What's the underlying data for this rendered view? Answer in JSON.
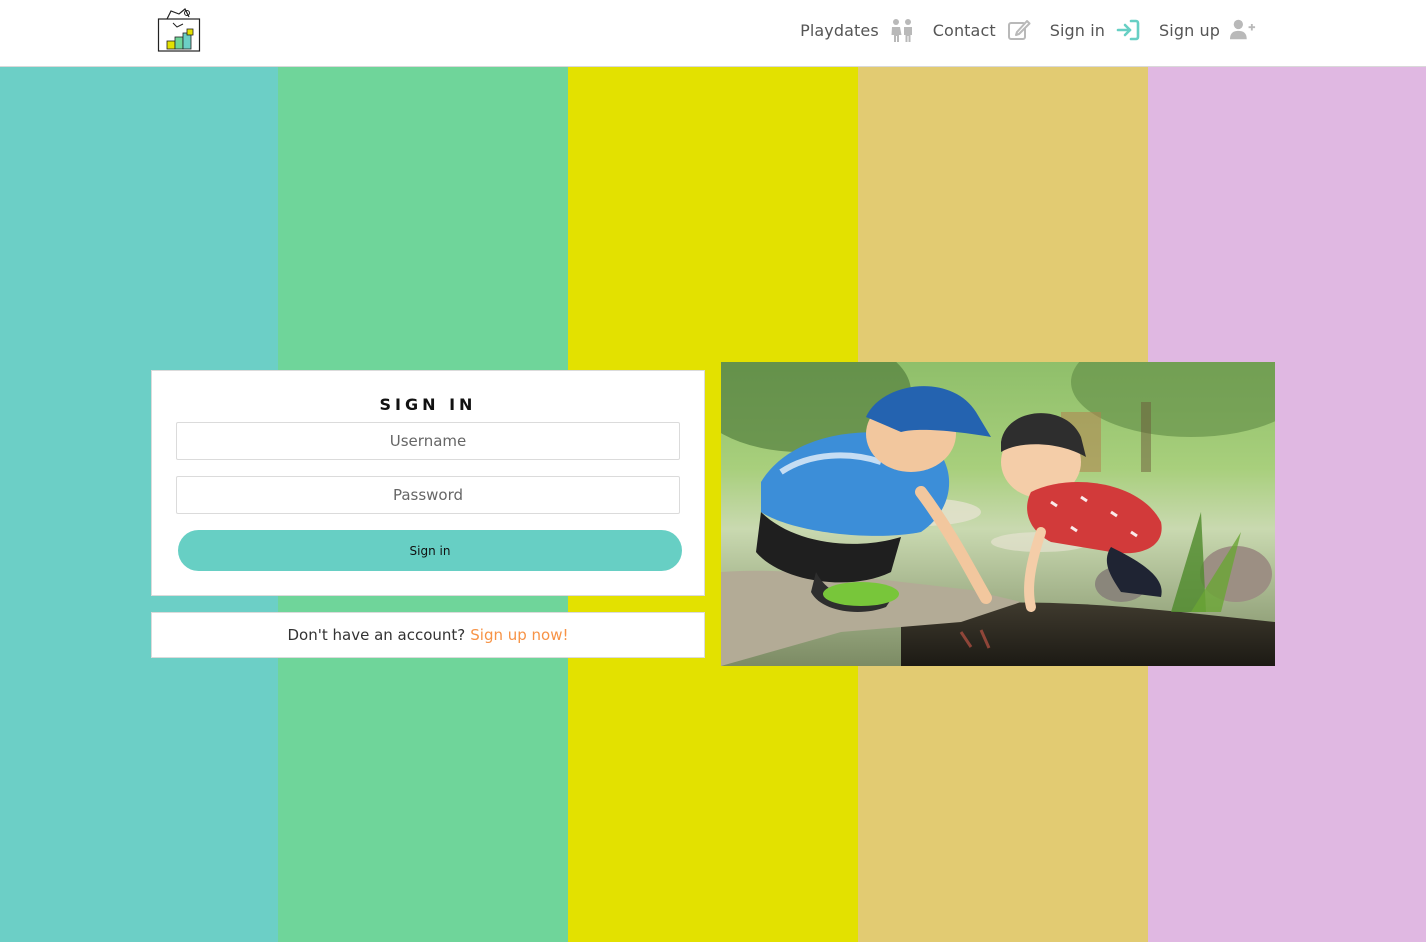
{
  "colors": {
    "stripes": [
      "#6ccfc6",
      "#6fd59a",
      "#e3e100",
      "#e2cb72",
      "#e0b8e2"
    ],
    "accent": "#67cfc4",
    "link": "#f79346",
    "muted_icon": "#b9b9b9"
  },
  "nav": {
    "items": [
      {
        "label": "Playdates",
        "icon": "children-icon"
      },
      {
        "label": "Contact",
        "icon": "edit-icon"
      },
      {
        "label": "Sign in",
        "icon": "sign-in-icon"
      },
      {
        "label": "Sign up",
        "icon": "user-plus-icon"
      }
    ]
  },
  "signin": {
    "title": "SIGN IN",
    "username_placeholder": "Username",
    "password_placeholder": "Password",
    "button_label": "Sign in"
  },
  "signup": {
    "question": "Don't have an account?",
    "link_label": "Sign up now!"
  }
}
